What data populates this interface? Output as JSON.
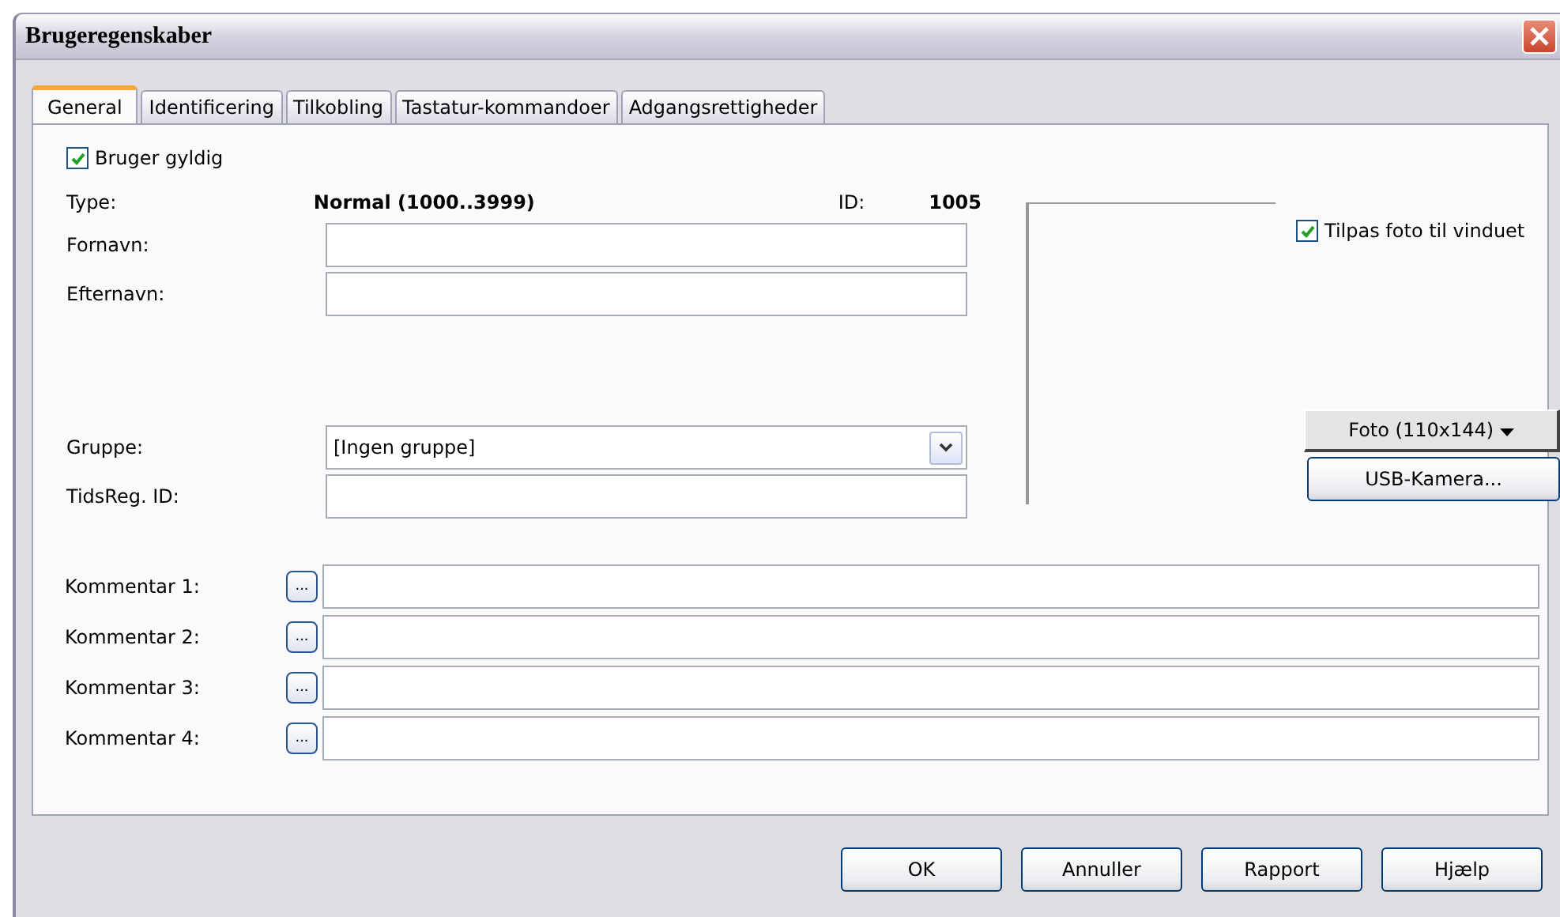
{
  "window": {
    "title": "Brugeregenskaber"
  },
  "tabs": [
    {
      "label": "General",
      "selected": true
    },
    {
      "label": "Identificering",
      "selected": false
    },
    {
      "label": "Tilkobling",
      "selected": false
    },
    {
      "label": "Tastatur-kommandoer",
      "selected": false
    },
    {
      "label": "Adgangsrettigheder",
      "selected": false
    }
  ],
  "valid": {
    "label": "Bruger gyldig",
    "checked": true
  },
  "type": {
    "label": "Type:",
    "value": "Normal (1000..3999)"
  },
  "id": {
    "label": "ID:",
    "value": "1005"
  },
  "first_name": {
    "label": "Fornavn:"
  },
  "last_name": {
    "label": "Efternavn:"
  },
  "group": {
    "label": "Gruppe:",
    "value": "[Ingen gruppe]"
  },
  "timereg": {
    "label": "TidsReg. ID:"
  },
  "photo": {
    "fit_label": "Tilpas foto til vinduet",
    "fit_checked": true,
    "photo_button": "Foto (110x144)",
    "camera_button": "USB-Kamera..."
  },
  "comments": [
    {
      "label": "Kommentar 1:",
      "button": "..."
    },
    {
      "label": "Kommentar 2:",
      "button": "..."
    },
    {
      "label": "Kommentar 3:",
      "button": "..."
    },
    {
      "label": "Kommentar 4:",
      "button": "..."
    }
  ],
  "buttons": [
    "OK",
    "Annuller",
    "Rapport",
    "Hjælp"
  ]
}
